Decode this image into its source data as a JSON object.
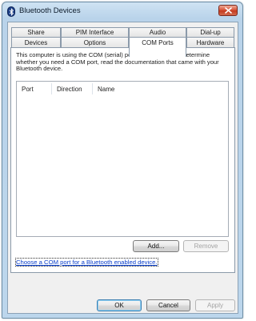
{
  "window": {
    "title": "Bluetooth Devices",
    "close_icon": "close-icon",
    "app_icon": "bluetooth-icon"
  },
  "tabs": {
    "row_back": [
      {
        "label": "Share"
      },
      {
        "label": "PIM Interface"
      },
      {
        "label": "Audio"
      },
      {
        "label": "Dial-up"
      }
    ],
    "row_front": [
      {
        "label": "Devices"
      },
      {
        "label": "Options"
      },
      {
        "label": "COM Ports",
        "active": true
      },
      {
        "label": "Hardware"
      }
    ]
  },
  "com_ports": {
    "description": "This computer is using the COM (serial) ports listed below. To determine whether you need a COM port, read the documentation that came with your Bluetooth device.",
    "columns": [
      "Port",
      "Direction",
      "Name"
    ],
    "rows": [],
    "add_label": "Add...",
    "remove_label": "Remove",
    "help_link": "Choose a COM port for a Bluetooth enabled device."
  },
  "footer": {
    "ok_label": "OK",
    "cancel_label": "Cancel",
    "apply_label": "Apply"
  },
  "colors": {
    "frame": "#bcd6ec",
    "close_button": "#c33a1f",
    "link": "#0a3fcb"
  }
}
